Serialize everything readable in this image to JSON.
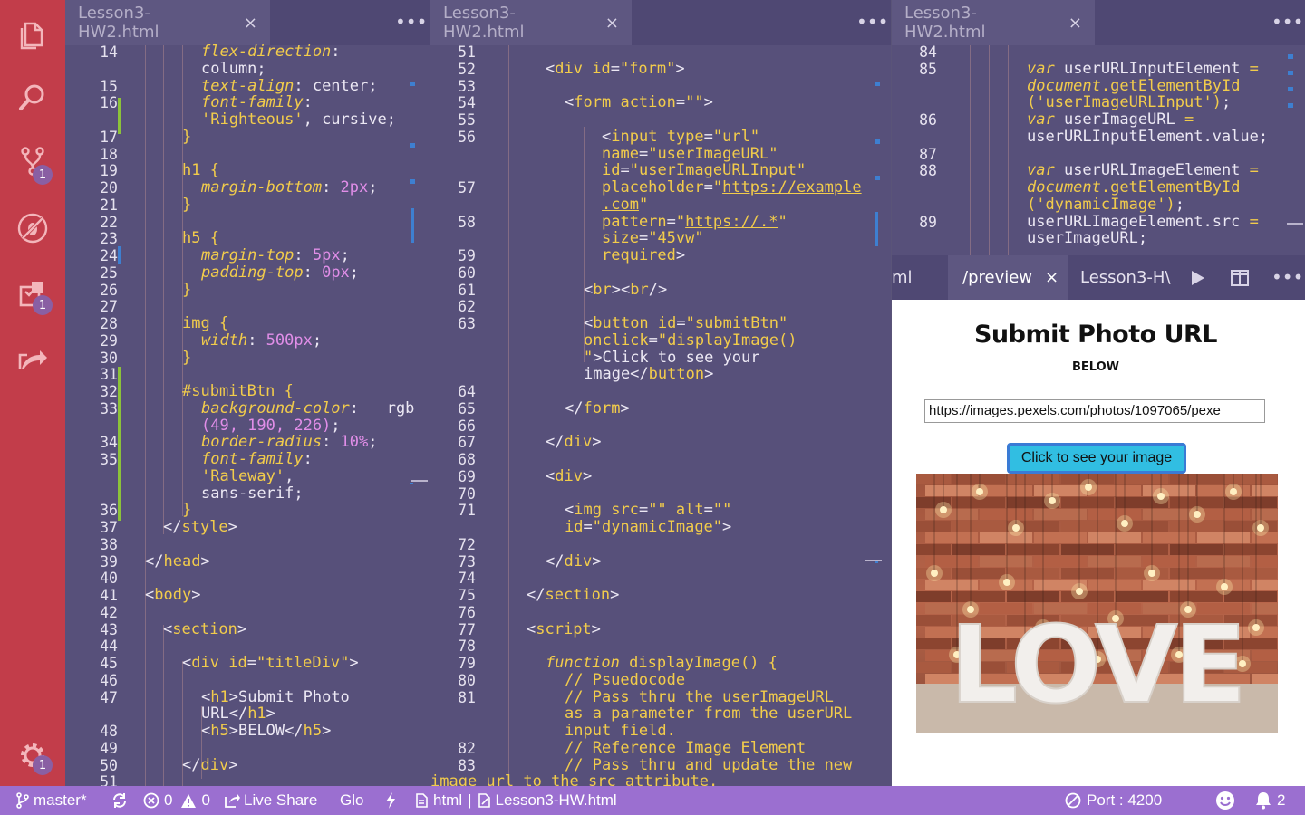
{
  "activity_bar": {
    "scm_badge": "1",
    "extensions_badge": "1",
    "settings_badge": "1"
  },
  "panes": [
    {
      "tab_title": "Lesson3-HW2.html",
      "close": "×",
      "more": "•••"
    },
    {
      "tab_title": "Lesson3-HW2.html",
      "close": "×",
      "more": "•••"
    },
    {
      "tab_title": "Lesson3-HW2.html",
      "close": "×",
      "more": "•••"
    }
  ],
  "pane1_lines": [
    {
      "n": "14",
      "tokens": [
        [
          "pr",
          "flex-direction"
        ],
        [
          "pu",
          ":"
        ]
      ]
    },
    {
      "n": "",
      "tokens": [
        [
          "tx",
          "column;"
        ]
      ]
    },
    {
      "n": "15",
      "tokens": [
        [
          "pr",
          "text-align"
        ],
        [
          "pu",
          ": center;"
        ]
      ]
    },
    {
      "n": "16",
      "tokens": [
        [
          "pr",
          "font-family"
        ],
        [
          "pu",
          ":"
        ]
      ]
    },
    {
      "n": "",
      "tokens": [
        [
          "st",
          "'Righteous'"
        ],
        [
          "pu",
          ", cursive;"
        ]
      ]
    },
    {
      "n": "17",
      "tokens": [
        [
          "kw",
          "}"
        ]
      ]
    },
    {
      "n": "18",
      "tokens": []
    },
    {
      "n": "19",
      "tokens": [
        [
          "sel",
          "h1 {"
        ]
      ]
    },
    {
      "n": "20",
      "tokens": [
        [
          "pr",
          "margin-bottom"
        ],
        [
          "pu",
          ": "
        ],
        [
          "nm",
          "2px"
        ],
        [
          "pu",
          ";"
        ]
      ]
    },
    {
      "n": "21",
      "tokens": [
        [
          "kw",
          "}"
        ]
      ]
    },
    {
      "n": "22",
      "tokens": []
    },
    {
      "n": "23",
      "tokens": [
        [
          "sel",
          "h5 {"
        ]
      ]
    },
    {
      "n": "24",
      "tokens": [
        [
          "pr",
          "margin-top"
        ],
        [
          "pu",
          ": "
        ],
        [
          "nm",
          "5px"
        ],
        [
          "pu",
          ";"
        ]
      ]
    },
    {
      "n": "25",
      "tokens": [
        [
          "pr",
          "padding-top"
        ],
        [
          "pu",
          ": "
        ],
        [
          "nm",
          "0px"
        ],
        [
          "pu",
          ";"
        ]
      ]
    },
    {
      "n": "26",
      "tokens": [
        [
          "kw",
          "}"
        ]
      ]
    },
    {
      "n": "27",
      "tokens": []
    },
    {
      "n": "28",
      "tokens": [
        [
          "sel",
          "img {"
        ]
      ]
    },
    {
      "n": "29",
      "tokens": [
        [
          "pr",
          "width"
        ],
        [
          "pu",
          ": "
        ],
        [
          "nm",
          "500px"
        ],
        [
          "pu",
          ";"
        ]
      ]
    },
    {
      "n": "30",
      "tokens": [
        [
          "kw",
          "}"
        ]
      ]
    },
    {
      "n": "31",
      "tokens": []
    },
    {
      "n": "32",
      "tokens": [
        [
          "sel",
          "#submitBtn {"
        ]
      ]
    },
    {
      "n": "33",
      "tokens": [
        [
          "pr",
          "background-color"
        ],
        [
          "pu",
          ":   rgb"
        ]
      ]
    },
    {
      "n": "",
      "tokens": [
        [
          "nm",
          "(49, 190, 226)"
        ],
        [
          "pu",
          ";"
        ]
      ]
    },
    {
      "n": "34",
      "tokens": [
        [
          "pr",
          "border-radius"
        ],
        [
          "pu",
          ": "
        ],
        [
          "nm",
          "10%"
        ],
        [
          "pu",
          ";"
        ]
      ]
    },
    {
      "n": "35",
      "tokens": [
        [
          "pr",
          "font-family"
        ],
        [
          "pu",
          ":"
        ]
      ]
    },
    {
      "n": "",
      "tokens": [
        [
          "st",
          "'Raleway'"
        ],
        [
          "pu",
          ","
        ]
      ]
    },
    {
      "n": "",
      "tokens": [
        [
          "tx",
          "sans-serif;"
        ]
      ]
    },
    {
      "n": "36",
      "tokens": [
        [
          "kw",
          "}"
        ]
      ]
    },
    {
      "n": "37",
      "tokens": [
        [
          "pu",
          "</"
        ],
        [
          "tg",
          "style"
        ],
        [
          "pu",
          ">"
        ]
      ]
    },
    {
      "n": "38",
      "tokens": []
    },
    {
      "n": "39",
      "tokens": [
        [
          "pu",
          "</"
        ],
        [
          "tg",
          "head"
        ],
        [
          "pu",
          ">"
        ]
      ]
    },
    {
      "n": "40",
      "tokens": []
    },
    {
      "n": "41",
      "tokens": [
        [
          "pu",
          "<"
        ],
        [
          "tg",
          "body"
        ],
        [
          "pu",
          ">"
        ]
      ]
    },
    {
      "n": "42",
      "tokens": []
    },
    {
      "n": "43",
      "tokens": [
        [
          "pu",
          "<"
        ],
        [
          "tg",
          "section"
        ],
        [
          "pu",
          ">"
        ]
      ]
    },
    {
      "n": "44",
      "tokens": []
    },
    {
      "n": "45",
      "tokens": [
        [
          "pu",
          "<"
        ],
        [
          "tg",
          "div"
        ],
        [
          "pu",
          " "
        ],
        [
          "at",
          "id"
        ],
        [
          "pu",
          "="
        ],
        [
          "st",
          "\"titleDiv\""
        ],
        [
          "pu",
          ">"
        ]
      ]
    },
    {
      "n": "46",
      "tokens": []
    },
    {
      "n": "47",
      "tokens": [
        [
          "pu",
          "<"
        ],
        [
          "tg",
          "h1"
        ],
        [
          "pu",
          ">Submit Photo"
        ]
      ]
    },
    {
      "n": "",
      "tokens": [
        [
          "pu",
          "URL</"
        ],
        [
          "tg",
          "h1"
        ],
        [
          "pu",
          ">"
        ]
      ]
    },
    {
      "n": "48",
      "tokens": [
        [
          "pu",
          "<"
        ],
        [
          "tg",
          "h5"
        ],
        [
          "pu",
          ">BELOW</"
        ],
        [
          "tg",
          "h5"
        ],
        [
          "pu",
          ">"
        ]
      ]
    },
    {
      "n": "49",
      "tokens": []
    },
    {
      "n": "50",
      "tokens": [
        [
          "pu",
          "</"
        ],
        [
          "tg",
          "div"
        ],
        [
          "pu",
          ">"
        ]
      ]
    },
    {
      "n": "51",
      "tokens": []
    }
  ],
  "pane2_lines": [
    {
      "n": "51",
      "tokens": []
    },
    {
      "n": "52",
      "tokens": [
        [
          "pu",
          "<"
        ],
        [
          "tg",
          "div"
        ],
        [
          "pu",
          " "
        ],
        [
          "at",
          "id"
        ],
        [
          "pu",
          "="
        ],
        [
          "st",
          "\"form\""
        ],
        [
          "pu",
          ">"
        ]
      ]
    },
    {
      "n": "53",
      "tokens": []
    },
    {
      "n": "54",
      "tokens": [
        [
          "pu",
          "<"
        ],
        [
          "tg",
          "form"
        ],
        [
          "pu",
          " "
        ],
        [
          "at",
          "action"
        ],
        [
          "pu",
          "="
        ],
        [
          "st",
          "\"\""
        ],
        [
          "pu",
          ">"
        ]
      ]
    },
    {
      "n": "55",
      "tokens": []
    },
    {
      "n": "56",
      "tokens": [
        [
          "pu",
          "<"
        ],
        [
          "tg",
          "input"
        ],
        [
          "pu",
          " "
        ],
        [
          "at",
          "type"
        ],
        [
          "pu",
          "="
        ],
        [
          "st",
          "\"url\""
        ]
      ]
    },
    {
      "n": "",
      "tokens": [
        [
          "at",
          "name"
        ],
        [
          "pu",
          "="
        ],
        [
          "st",
          "\"userImageURL\""
        ]
      ]
    },
    {
      "n": "",
      "tokens": [
        [
          "at",
          "id"
        ],
        [
          "pu",
          "="
        ],
        [
          "st",
          "\"userImageURLInput\""
        ]
      ]
    },
    {
      "n": "57",
      "tokens": [
        [
          "at",
          "placeholder"
        ],
        [
          "pu",
          "="
        ],
        [
          "st",
          "\""
        ],
        [
          "url",
          "https://example"
        ]
      ]
    },
    {
      "n": "",
      "tokens": [
        [
          "url",
          ".com"
        ],
        [
          "st",
          "\""
        ]
      ]
    },
    {
      "n": "58",
      "tokens": [
        [
          "at",
          "pattern"
        ],
        [
          "pu",
          "="
        ],
        [
          "st",
          "\""
        ],
        [
          "url",
          "https://.*"
        ],
        [
          "st",
          "\""
        ]
      ]
    },
    {
      "n": "",
      "tokens": [
        [
          "at",
          "size"
        ],
        [
          "pu",
          "="
        ],
        [
          "st",
          "\"45vw\""
        ]
      ]
    },
    {
      "n": "59",
      "tokens": [
        [
          "at",
          "required"
        ],
        [
          "pu",
          ">"
        ]
      ]
    },
    {
      "n": "60",
      "tokens": []
    },
    {
      "n": "61",
      "tokens": [
        [
          "pu",
          "<"
        ],
        [
          "tg",
          "br"
        ],
        [
          "pu",
          "><"
        ],
        [
          "tg",
          "br"
        ],
        [
          "pu",
          "/>"
        ]
      ]
    },
    {
      "n": "62",
      "tokens": []
    },
    {
      "n": "63",
      "tokens": [
        [
          "pu",
          "<"
        ],
        [
          "tg",
          "button"
        ],
        [
          "pu",
          " "
        ],
        [
          "at",
          "id"
        ],
        [
          "pu",
          "="
        ],
        [
          "st",
          "\"submitBtn\""
        ]
      ]
    },
    {
      "n": "",
      "tokens": [
        [
          "at",
          "onclick"
        ],
        [
          "pu",
          "="
        ],
        [
          "st",
          "\"displayImage()"
        ]
      ]
    },
    {
      "n": "",
      "tokens": [
        [
          "st",
          "\""
        ],
        [
          "pu",
          ">Click to see your"
        ]
      ]
    },
    {
      "n": "",
      "tokens": [
        [
          "pu",
          "image</"
        ],
        [
          "tg",
          "button"
        ],
        [
          "pu",
          ">"
        ]
      ]
    },
    {
      "n": "64",
      "tokens": []
    },
    {
      "n": "65",
      "tokens": [
        [
          "pu",
          "</"
        ],
        [
          "tg",
          "form"
        ],
        [
          "pu",
          ">"
        ]
      ]
    },
    {
      "n": "66",
      "tokens": []
    },
    {
      "n": "67",
      "tokens": [
        [
          "pu",
          "</"
        ],
        [
          "tg",
          "div"
        ],
        [
          "pu",
          ">"
        ]
      ]
    },
    {
      "n": "68",
      "tokens": []
    },
    {
      "n": "69",
      "tokens": [
        [
          "pu",
          "<"
        ],
        [
          "tg",
          "div"
        ],
        [
          "pu",
          ">"
        ]
      ]
    },
    {
      "n": "70",
      "tokens": []
    },
    {
      "n": "71",
      "tokens": [
        [
          "pu",
          "<"
        ],
        [
          "tg",
          "img"
        ],
        [
          "pu",
          " "
        ],
        [
          "at",
          "src"
        ],
        [
          "pu",
          "="
        ],
        [
          "st",
          "\"\""
        ],
        [
          "pu",
          " "
        ],
        [
          "at",
          "alt"
        ],
        [
          "pu",
          "="
        ],
        [
          "st",
          "\"\""
        ]
      ]
    },
    {
      "n": "",
      "tokens": [
        [
          "at",
          "id"
        ],
        [
          "pu",
          "="
        ],
        [
          "st",
          "\"dynamicImage\""
        ],
        [
          "pu",
          ">"
        ]
      ]
    },
    {
      "n": "72",
      "tokens": []
    },
    {
      "n": "73",
      "tokens": [
        [
          "pu",
          "</"
        ],
        [
          "tg",
          "div"
        ],
        [
          "pu",
          ">"
        ]
      ]
    },
    {
      "n": "74",
      "tokens": []
    },
    {
      "n": "75",
      "tokens": [
        [
          "pu",
          "</"
        ],
        [
          "tg",
          "section"
        ],
        [
          "pu",
          ">"
        ]
      ]
    },
    {
      "n": "76",
      "tokens": []
    },
    {
      "n": "77",
      "tokens": [
        [
          "pu",
          "<"
        ],
        [
          "tg",
          "script"
        ],
        [
          "pu",
          ">"
        ]
      ]
    },
    {
      "n": "78",
      "tokens": []
    },
    {
      "n": "79",
      "tokens": [
        [
          "fn",
          "function"
        ],
        [
          "pu",
          " "
        ],
        [
          "kw",
          "displayImage() {"
        ]
      ]
    },
    {
      "n": "80",
      "tokens": [
        [
          "cm",
          "// Psuedocode"
        ]
      ]
    },
    {
      "n": "81",
      "tokens": [
        [
          "cm",
          "// Pass thru the userImageURL"
        ]
      ]
    },
    {
      "n": "",
      "tokens": [
        [
          "cm",
          "as a parameter from the userURL"
        ]
      ]
    },
    {
      "n": "",
      "tokens": [
        [
          "cm",
          "input field."
        ]
      ]
    },
    {
      "n": "82",
      "tokens": [
        [
          "cm",
          "// Reference Image Element"
        ]
      ]
    },
    {
      "n": "83",
      "tokens": [
        [
          "cm",
          "// Pass thru and update the new"
        ]
      ]
    },
    {
      "n": "",
      "tokens": [
        [
          "cm",
          "image url to the src attribute."
        ]
      ]
    }
  ],
  "pane3_lines": [
    {
      "n": "84",
      "tokens": []
    },
    {
      "n": "85",
      "tokens": [
        [
          "fn",
          "var"
        ],
        [
          "pu",
          " userURLInputElement "
        ],
        [
          "kw",
          "="
        ]
      ]
    },
    {
      "n": "",
      "tokens": [
        [
          "fn",
          "document"
        ],
        [
          "kw",
          "."
        ],
        [
          "kw",
          "getElementById"
        ]
      ]
    },
    {
      "n": "",
      "tokens": [
        [
          "kw",
          "("
        ],
        [
          "st",
          "'userImageURLInput'"
        ],
        [
          "kw",
          ")"
        ],
        [
          "pu",
          ";"
        ]
      ]
    },
    {
      "n": "86",
      "tokens": [
        [
          "fn",
          "var"
        ],
        [
          "pu",
          " userImageURL "
        ],
        [
          "kw",
          "="
        ]
      ]
    },
    {
      "n": "",
      "tokens": [
        [
          "pu",
          "userURLInputElement.value;"
        ]
      ]
    },
    {
      "n": "87",
      "tokens": []
    },
    {
      "n": "88",
      "tokens": [
        [
          "fn",
          "var"
        ],
        [
          "pu",
          " userURLImageElement "
        ],
        [
          "kw",
          "="
        ]
      ]
    },
    {
      "n": "",
      "tokens": [
        [
          "fn",
          "document"
        ],
        [
          "kw",
          "."
        ],
        [
          "kw",
          "getElementById"
        ]
      ]
    },
    {
      "n": "",
      "tokens": [
        [
          "kw",
          "("
        ],
        [
          "st",
          "'dynamicImage'"
        ],
        [
          "kw",
          ")"
        ],
        [
          "pu",
          ";"
        ]
      ]
    },
    {
      "n": "89",
      "tokens": [
        [
          "pu",
          "userURLImageElement.src "
        ],
        [
          "kw",
          "="
        ]
      ]
    },
    {
      "n": "",
      "tokens": [
        [
          "pu",
          "userImageURL;"
        ]
      ]
    }
  ],
  "preview": {
    "tabs": [
      {
        "label": "ml"
      },
      {
        "label": "/preview",
        "close": "×"
      },
      {
        "label": "Lesson3-H\\"
      }
    ],
    "more": "•••",
    "heading": "Submit Photo URL",
    "subheading": "BELOW",
    "url_value": "https://images.pexels.com/photos/1097065/pexe",
    "button_label": "Click to see your image",
    "image_text": "LOVE"
  },
  "status": {
    "branch": "master*",
    "errors": "0",
    "warnings": "0",
    "live_share": "Live Share",
    "glo": "Glo",
    "language": "html",
    "separator": "|",
    "file": "Lesson3-HW.html",
    "port": "Port : 4200",
    "notifications": "2"
  },
  "colors": {
    "activity_bar": "#c23d4a",
    "editor_bg": "#57507a",
    "status_bar": "#9b6fd0",
    "keyword": "#f2cc4b",
    "number": "#e18ee8",
    "button_blue": "#31bee2"
  }
}
